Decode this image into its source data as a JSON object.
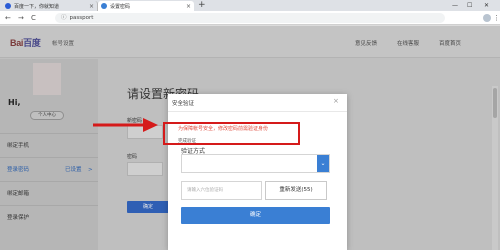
{
  "browser": {
    "tabs": [
      {
        "title": "百度一下，你就知道",
        "close": "×",
        "active": false
      },
      {
        "title": "设置密码",
        "close": "×",
        "active": true
      }
    ],
    "new_tab": "+",
    "window_controls": [
      "—",
      "☐",
      "✕"
    ],
    "nav": {
      "back": "←",
      "forward": "→",
      "reload": "C"
    },
    "url": "passport",
    "lock": "ⓘ",
    "menu": "⋮"
  },
  "header": {
    "logo_text": "Bai",
    "logo_du": "百度",
    "subtitle": "帐号设置",
    "nav": [
      "意见反馈",
      "在线客服",
      "百度首页"
    ]
  },
  "sidebar": {
    "username": "Hi,",
    "center_button": "个人中心",
    "items": [
      {
        "label": "绑定手机",
        "status": "",
        "chevron": ""
      },
      {
        "label": "登录密码",
        "status": "已设置",
        "chevron": ">",
        "active": true
      },
      {
        "label": "绑定邮箱",
        "status": "",
        "chevron": ""
      },
      {
        "label": "登录保护",
        "status": "",
        "chevron": ""
      }
    ]
  },
  "main": {
    "title": "请设置新密码",
    "label_1": "新密码",
    "label_2": "密码",
    "confirm": "确定"
  },
  "modal": {
    "title": "安全验证",
    "close": "×",
    "notice": "为保障帐号安全，修改密码前需验证身份",
    "small_label": "完成验证",
    "method_label": "验证方式",
    "select_value": "",
    "select_arrow": "⌄",
    "code_placeholder": "请输入六位验证码",
    "resend_label": "重新发送(55)",
    "confirm_label": "确定"
  },
  "colors": {
    "annotation": "#d51a1a",
    "notice_text": "#e04a3c",
    "primary": "#3a7fd4"
  }
}
